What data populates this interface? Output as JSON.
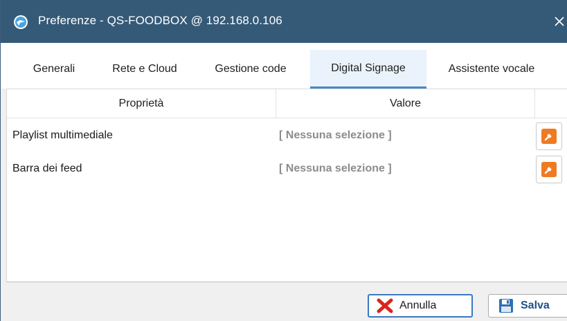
{
  "window": {
    "title": "Preferenze - QS-FOODBOX @ 192.168.0.106",
    "close_symbol": "✕"
  },
  "tabs": [
    {
      "label": "Generali",
      "active": false
    },
    {
      "label": "Rete e Cloud",
      "active": false
    },
    {
      "label": "Gestione code",
      "active": false
    },
    {
      "label": "Digital Signage",
      "active": true
    },
    {
      "label": "Assistente vocale",
      "active": false
    }
  ],
  "grid": {
    "columns": {
      "property": "Proprietà",
      "value": "Valore"
    },
    "rows": [
      {
        "property": "Playlist multimediale",
        "value": "[ Nessuna selezione ]",
        "action_icon": "wrench-icon"
      },
      {
        "property": "Barra dei feed",
        "value": "[ Nessuna selezione ]",
        "action_icon": "wrench-icon"
      }
    ]
  },
  "footer": {
    "cancel_label": "Annulla",
    "cancel_icon": "red-x-icon",
    "save_label": "Salva",
    "save_icon": "floppy-disk-icon"
  },
  "colors": {
    "titlebar": "#355a78",
    "active_tab_underline": "#4a86c5",
    "wrench_accent": "#ef7a22",
    "cancel_x": "#d9251c",
    "save_accent": "#1f4f86"
  }
}
